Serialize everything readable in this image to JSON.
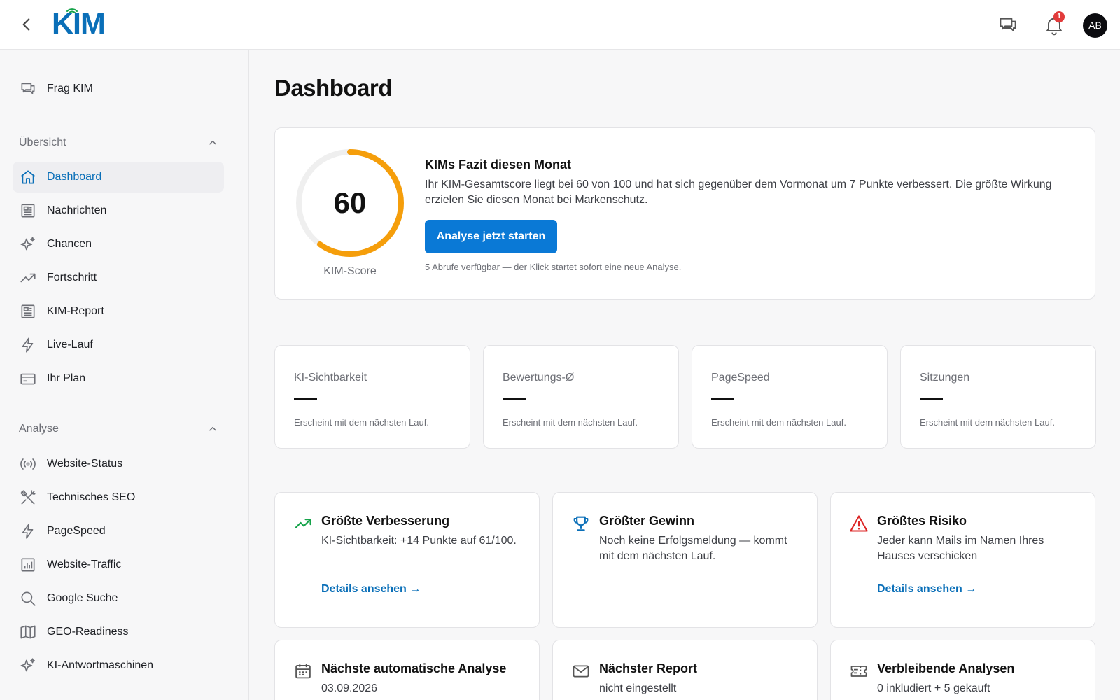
{
  "topbar": {
    "logo": "KIM",
    "notification_count": "1",
    "avatar_initials": "AB"
  },
  "sidebar": {
    "ask": "Frag KIM",
    "section_overview": "Übersicht",
    "overview_items": [
      "Dashboard",
      "Nachrichten",
      "Chancen",
      "Fortschritt",
      "KIM-Report",
      "Live-Lauf",
      "Ihr Plan"
    ],
    "section_analysis": "Analyse",
    "analysis_items": [
      "Website-Status",
      "Technisches SEO",
      "PageSpeed",
      "Website-Traffic",
      "Google Suche",
      "GEO-Readiness",
      "KI-Antwortmaschinen"
    ]
  },
  "page": {
    "title": "Dashboard"
  },
  "score": {
    "value": "60",
    "max": 100,
    "label": "KIM-Score",
    "title": "KIMs Fazit diesen Monat",
    "text": "Ihr KIM-Gesamtscore liegt bei 60 von 100 und hat sich gegenüber dem Vormonat um 7 Punkte verbessert. Die größte Wirkung erzielen Sie diesen Monat bei Markenschutz.",
    "button": "Analyse jetzt starten",
    "hint": "5 Abrufe verfügbar — der Klick startet sofort eine neue Analyse."
  },
  "metrics": [
    {
      "label": "KI-Sichtbarkeit",
      "hint": "Erscheint mit dem nächsten Lauf."
    },
    {
      "label": "Bewertungs-Ø",
      "hint": "Erscheint mit dem nächsten Lauf."
    },
    {
      "label": "PageSpeed",
      "hint": "Erscheint mit dem nächsten Lauf."
    },
    {
      "label": "Sitzungen",
      "hint": "Erscheint mit dem nächsten Lauf."
    }
  ],
  "highlights": [
    {
      "title": "Größte Verbesserung",
      "text": "KI-Sichtbarkeit: +14 Punkte auf 61/100.",
      "link": "Details ansehen →"
    },
    {
      "title": "Größter Gewinn",
      "text": "Noch keine Erfolgsmeldung — kommt mit dem nächsten Lauf.",
      "link": ""
    },
    {
      "title": "Größtes Risiko",
      "text": "Jeder kann Mails im Namen Ihres Hauses verschicken",
      "link": "Details ansehen →"
    }
  ],
  "schedule": [
    {
      "title": "Nächste automatische Analyse",
      "text": "03.09.2026"
    },
    {
      "title": "Nächster Report",
      "text": "nicht eingestellt"
    },
    {
      "title": "Verbleibende Analysen",
      "text": "0 inkludiert + 5 gekauft"
    }
  ],
  "colors": {
    "accent": "#0a79d6",
    "gauge": "#f59e0b",
    "success": "#16a34a",
    "risk": "#dc2626"
  }
}
